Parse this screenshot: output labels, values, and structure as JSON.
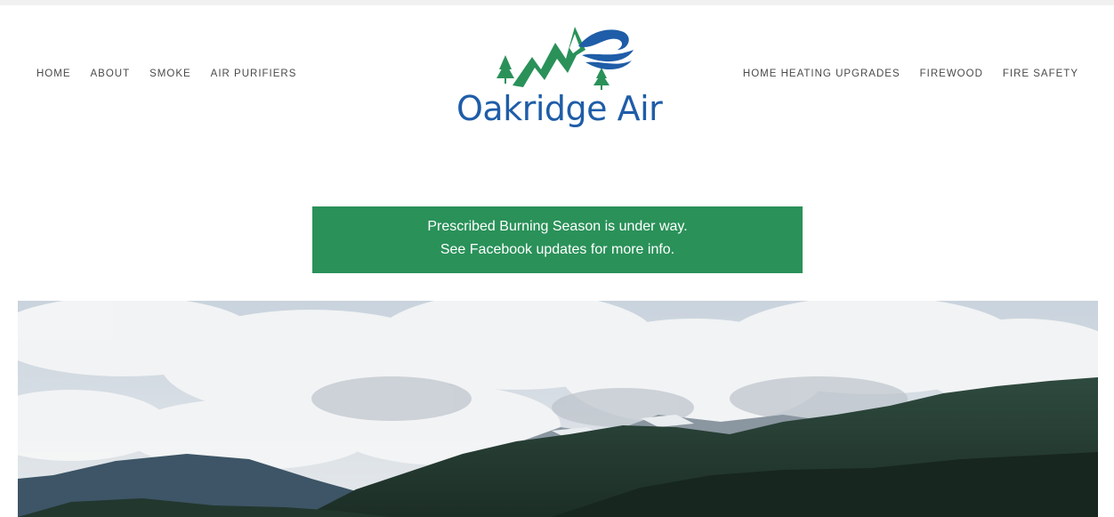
{
  "nav": {
    "left": [
      "HOME",
      "ABOUT",
      "SMOKE",
      "AIR PURIFIERS"
    ],
    "right": [
      "HOME HEATING UPGRADES",
      "FIREWOOD",
      "FIRE SAFETY"
    ]
  },
  "logo": {
    "text": "Oakridge Air",
    "colors": {
      "text": "#1f5da8",
      "mountain": "#2a9159",
      "wave": "#1f5da8"
    }
  },
  "banner": {
    "line1": "Prescribed Burning Season is under way.",
    "line2": "See Facebook updates for more info.",
    "background": "#2a9159"
  },
  "hero": {
    "description_icon": "mountain-landscape-photo"
  }
}
